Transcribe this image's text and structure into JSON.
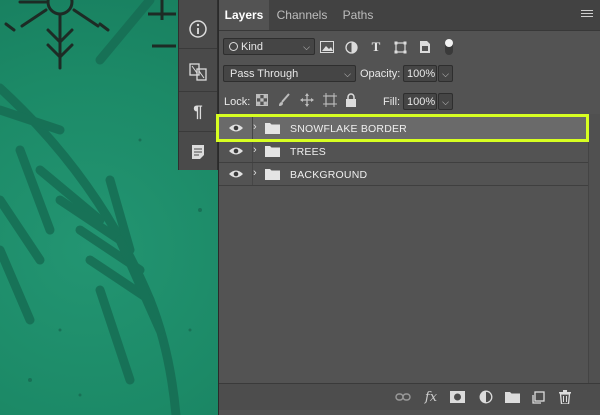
{
  "panel": {
    "tabs": [
      {
        "label": "Layers",
        "active": true
      },
      {
        "label": "Channels",
        "active": false
      },
      {
        "label": "Paths",
        "active": false
      }
    ],
    "filter": {
      "kind_label": "Kind",
      "icons": [
        "image-filter-icon",
        "adjustment-filter-icon",
        "type-filter-icon",
        "shape-filter-icon",
        "smart-object-filter-icon",
        "filter-toggle-icon"
      ]
    },
    "blend": {
      "mode": "Pass Through",
      "opacity_label": "Opacity:",
      "opacity_value": "100%"
    },
    "lock": {
      "label": "Lock:",
      "icons": [
        "lock-transparent-pixels-icon",
        "lock-image-pixels-icon",
        "lock-position-icon",
        "lock-artboard-icon",
        "lock-all-icon"
      ],
      "fill_label": "Fill:",
      "fill_value": "100%"
    },
    "layers": [
      {
        "name": "SNOWFLAKE BORDER",
        "type": "group",
        "visible": true,
        "selected": true
      },
      {
        "name": "TREES",
        "type": "group",
        "visible": true,
        "selected": false
      },
      {
        "name": "BACKGROUND",
        "type": "group",
        "visible": true,
        "selected": false
      }
    ],
    "bottom_icons": [
      "link-layers-icon",
      "layer-style-icon",
      "layer-mask-icon",
      "adjustment-layer-icon",
      "new-group-icon",
      "new-layer-icon",
      "delete-layer-icon"
    ],
    "fx_label": "fx"
  },
  "dock": {
    "icons": [
      "info-icon",
      "clone-source-icon",
      "paragraph-icon",
      "notes-icon"
    ],
    "paragraph_glyph": "¶"
  },
  "colors": {
    "canvas_green": "#1e8a68",
    "panel_bg": "#535353",
    "highlight": "#d7ff21"
  }
}
